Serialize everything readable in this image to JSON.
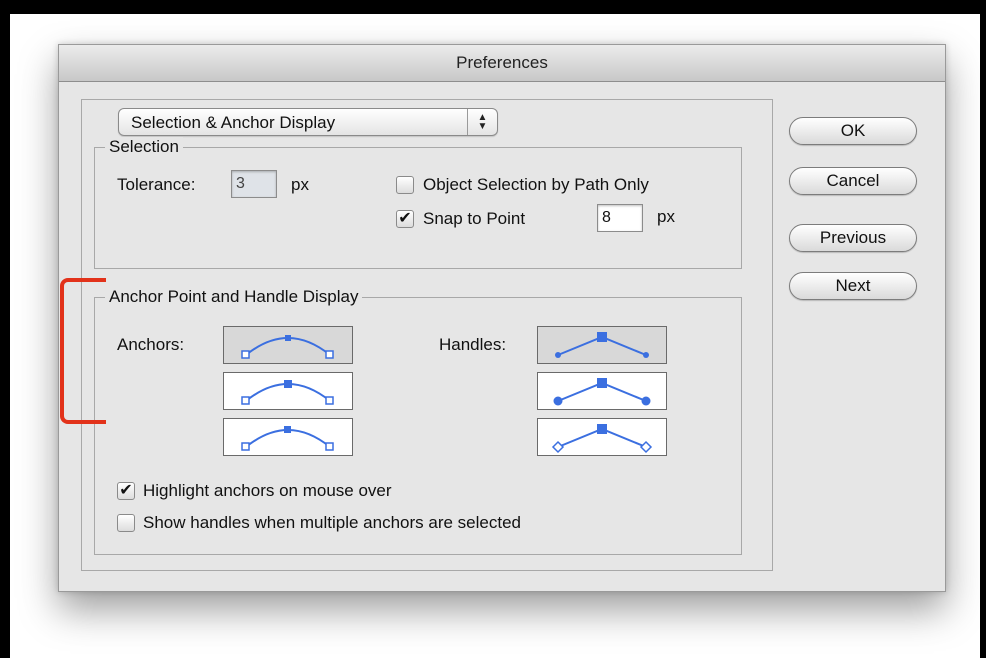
{
  "window": {
    "title": "Preferences"
  },
  "panel_selector": {
    "value": "Selection & Anchor Display"
  },
  "selection": {
    "group_label": "Selection",
    "tolerance_label": "Tolerance:",
    "tolerance_value": "3",
    "tolerance_unit": "px",
    "object_selection_label": "Object Selection by Path Only",
    "object_selection_checked": false,
    "snap_label": "Snap to Point",
    "snap_checked": true,
    "snap_value": "8",
    "snap_unit": "px"
  },
  "anchor_display": {
    "group_label": "Anchor Point and Handle Display",
    "anchors_label": "Anchors:",
    "handles_label": "Handles:",
    "anchors_selected_index": 0,
    "handles_selected_index": 0,
    "highlight_label": "Highlight anchors on mouse over",
    "highlight_checked": true,
    "show_handles_label": "Show handles when multiple anchors are selected",
    "show_handles_checked": false
  },
  "buttons": {
    "ok": "OK",
    "cancel": "Cancel",
    "previous": "Previous",
    "next": "Next"
  },
  "icons": {
    "checkmark": "✔",
    "popup_up": "▲",
    "popup_down": "▼"
  },
  "colors": {
    "accent_blue": "#3b6fe0",
    "annotation_red": "#e2321a"
  }
}
